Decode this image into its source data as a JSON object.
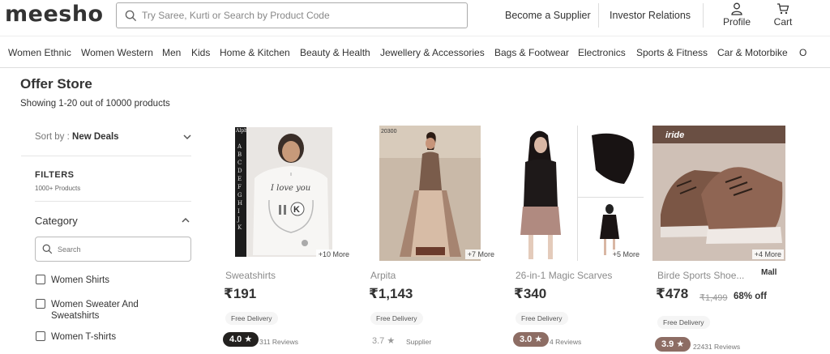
{
  "header": {
    "logo": "meesho",
    "search_placeholder": "Try Saree, Kurti or Search by Product Code",
    "become_supplier": "Become a Supplier",
    "investor_relations": "Investor Relations",
    "profile": "Profile",
    "cart": "Cart"
  },
  "categories": [
    "Women Ethnic",
    "Women Western",
    "Men",
    "Kids",
    "Home & Kitchen",
    "Beauty & Health",
    "Jewellery & Accessories",
    "Bags & Footwear",
    "Electronics",
    "Sports & Fitness",
    "Car & Motorbike",
    "O"
  ],
  "page": {
    "title": "Offer Store",
    "showing": "Showing 1-20 out of 10000 products"
  },
  "sidebar": {
    "sort_prefix": "Sort by : ",
    "sort_value": "New Deals",
    "filters": "FILTERS",
    "filters_sub": "1000+ Products",
    "category_title": "Category",
    "search_placeholder": "Search",
    "options": [
      "Women Shirts",
      "Women Sweater And Sweatshirts",
      "Women T-shirts"
    ]
  },
  "products": [
    {
      "name": "Sweatshirts",
      "price": "₹191",
      "more": "+10 More",
      "delivery": "Free Delivery",
      "rating": "4.0 ★",
      "reviews": "311 Reviews",
      "rating_color": "#23211f"
    },
    {
      "name": "Arpita",
      "price": "₹1,143",
      "more": "+7 More",
      "delivery": "Free Delivery",
      "rating": "3.7 ★",
      "reviews": "Supplier",
      "rating_color": "none"
    },
    {
      "name": "26-in-1 Magic Scarves",
      "price": "₹340",
      "more": "+5 More",
      "delivery": "Free Delivery",
      "rating": "3.0 ★",
      "reviews": "4 Reviews",
      "rating_color": "#8d6d64"
    },
    {
      "name": "Birde Sports Shoe...",
      "price": "₹478",
      "strike": "₹1,499",
      "off": "68% off",
      "more": "+4 More",
      "delivery": "Free Delivery",
      "rating": "3.9 ★",
      "reviews": "22431 Reviews",
      "rating_color": "#8d6d64",
      "badge": "Mall"
    }
  ],
  "image_texts": {
    "p1_top": "Alph",
    "p1_print": "I love you",
    "p1_letter": "K",
    "p2_top": "20300",
    "p4_brand": "iride"
  }
}
